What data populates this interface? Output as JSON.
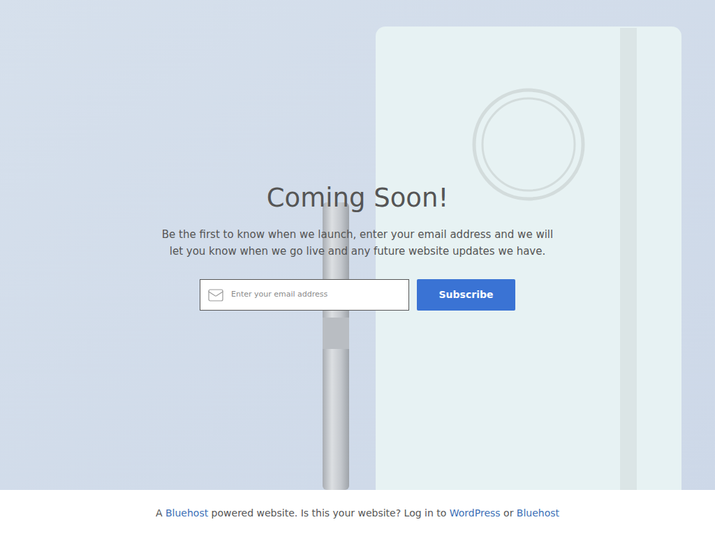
{
  "page": {
    "heading": "Coming Soon!",
    "description": "Be the first to know when we launch, enter your email address and we will let you know when we go live and any future website updates we have."
  },
  "subscribe": {
    "placeholder": "Enter your email address",
    "button": "Subscribe"
  },
  "footer": {
    "segments": [
      {
        "text": "A ",
        "link": false
      },
      {
        "text": "Bluehost",
        "link": true
      },
      {
        "text": " powered website. Is this your website? Log in to ",
        "link": false
      },
      {
        "text": "WordPress",
        "link": true
      },
      {
        "text": " or ",
        "link": false
      },
      {
        "text": "Bluehost",
        "link": true
      }
    ]
  }
}
